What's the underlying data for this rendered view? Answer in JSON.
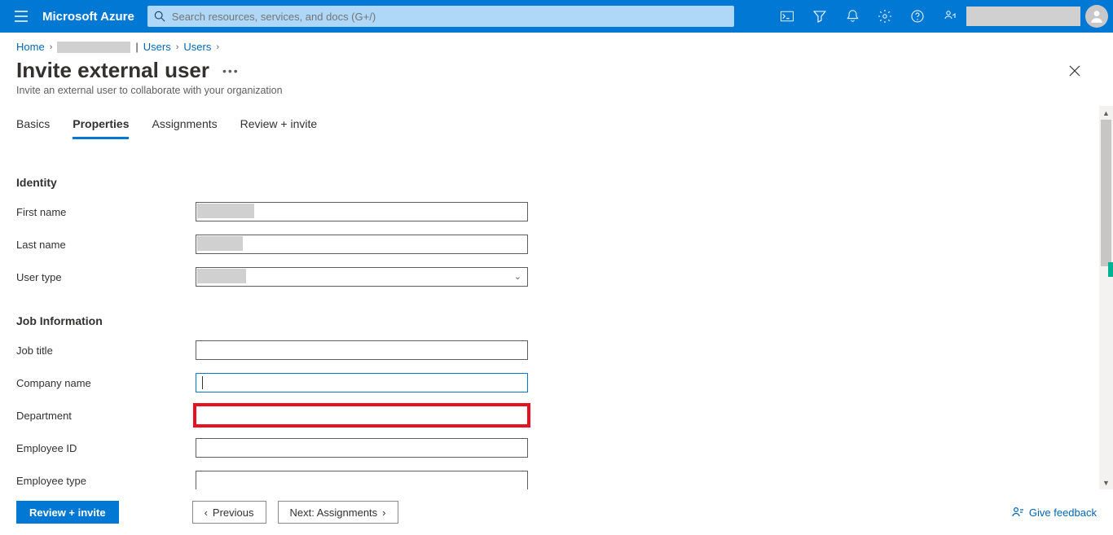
{
  "brand": "Microsoft Azure",
  "search": {
    "placeholder": "Search resources, services, and docs (G+/)"
  },
  "breadcrumb": {
    "home": "Home",
    "users1": "Users",
    "users2": "Users",
    "sep_pipe": "|"
  },
  "page": {
    "title": "Invite external user",
    "subtitle": "Invite an external user to collaborate with your organization"
  },
  "tabs": {
    "basics": "Basics",
    "properties": "Properties",
    "assignments": "Assignments",
    "review": "Review + invite"
  },
  "sections": {
    "identity": "Identity",
    "job": "Job Information"
  },
  "fields": {
    "first_name": {
      "label": "First name",
      "value": ""
    },
    "last_name": {
      "label": "Last name",
      "value": ""
    },
    "user_type": {
      "label": "User type",
      "value": ""
    },
    "job_title": {
      "label": "Job title",
      "value": ""
    },
    "company_name": {
      "label": "Company name",
      "value": ""
    },
    "department": {
      "label": "Department",
      "value": ""
    },
    "employee_id": {
      "label": "Employee ID",
      "value": ""
    },
    "employee_type": {
      "label": "Employee type",
      "value": ""
    }
  },
  "buttons": {
    "review_invite": "Review + invite",
    "previous": "Previous",
    "next": "Next: Assignments"
  },
  "feedback": "Give feedback",
  "colors": {
    "azure_blue": "#0078d4",
    "link_blue": "#0067b8",
    "highlight_red": "#e81123"
  }
}
